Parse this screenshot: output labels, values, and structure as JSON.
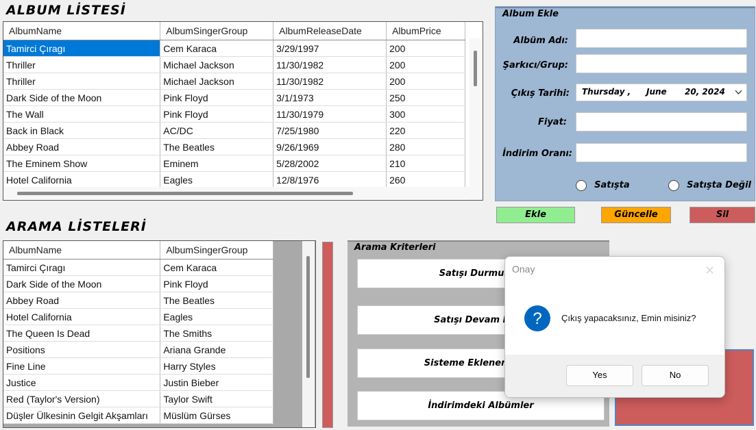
{
  "album_list": {
    "title": "ALBUM LİSTESİ",
    "columns": [
      "AlbumName",
      "AlbumSingerGroup",
      "AlbumReleaseDate",
      "AlbumPrice"
    ],
    "rows": [
      [
        "Tamirci Çıragı",
        "Cem Karaca",
        "3/29/1997",
        "200"
      ],
      [
        "Thriller",
        "Michael Jackson",
        "11/30/1982",
        "200"
      ],
      [
        "Thriller",
        "Michael Jackson",
        "11/30/1982",
        "200"
      ],
      [
        "Dark Side of the Moon",
        "Pink Floyd",
        "3/1/1973",
        "250"
      ],
      [
        "The Wall",
        "Pink Floyd",
        "11/30/1979",
        "300"
      ],
      [
        "Back in Black",
        "AC/DC",
        "7/25/1980",
        "220"
      ],
      [
        "Abbey Road",
        "The Beatles",
        "9/26/1969",
        "280"
      ],
      [
        "The Eminem Show",
        "Eminem",
        "5/28/2002",
        "210"
      ],
      [
        "Hotel California",
        "Eagles",
        "12/8/1976",
        "260"
      ]
    ]
  },
  "search_list": {
    "title": "ARAMA LİSTELERİ",
    "columns": [
      "AlbumName",
      "AlbumSingerGroup"
    ],
    "rows": [
      [
        "Tamirci Çıragı",
        "Cem Karaca"
      ],
      [
        "Dark Side of the Moon",
        "Pink Floyd"
      ],
      [
        "Abbey Road",
        "The Beatles"
      ],
      [
        "Hotel California",
        "Eagles"
      ],
      [
        "The Queen Is Dead",
        "The Smiths"
      ],
      [
        "Positions",
        "Ariana Grande"
      ],
      [
        "Fine Line",
        "Harry Styles"
      ],
      [
        "Justice",
        "Justin Bieber"
      ],
      [
        "Red (Taylor's Version)",
        "Taylor Swift"
      ],
      [
        "Düşler Ülkesinin Gelgit Akşamları",
        "Müslüm Gürses"
      ]
    ]
  },
  "album_form": {
    "title": "Album Ekle",
    "album_name_label": "Albüm Adı:",
    "singer_label": "Şarkıcı/Grup:",
    "release_label": "Çıkış Tarihi:",
    "price_label": "Fiyat:",
    "discount_label": "İndirim Oranı:",
    "date_weekday": "Thursday ,",
    "date_month": "June",
    "date_day_year": "20, 2024",
    "radio_on_sale": "Satışta",
    "radio_not_on_sale": "Satışta Değil"
  },
  "actions": {
    "add": "Ekle",
    "update": "Güncelle",
    "delete": "Sil"
  },
  "criteria": {
    "title": "Arama Kriterleri",
    "buttons": [
      "Satışı Durmuş Al",
      "Satışı Devam Eden",
      "Sisteme Eklenen En so",
      "İndirimdeki Albümler"
    ]
  },
  "dialog": {
    "title": "Onay",
    "message": "Çıkış yapacaksınız, Emin misiniz?",
    "yes": "Yes",
    "no": "No",
    "icon": "question-icon"
  },
  "colors": {
    "selection": "#0078d7",
    "form_bg": "#9eb7d3",
    "add_btn": "#90ee90",
    "update_btn": "#ffa500",
    "delete_btn": "#cd5c5c",
    "dialog_icon": "#0067c0"
  }
}
